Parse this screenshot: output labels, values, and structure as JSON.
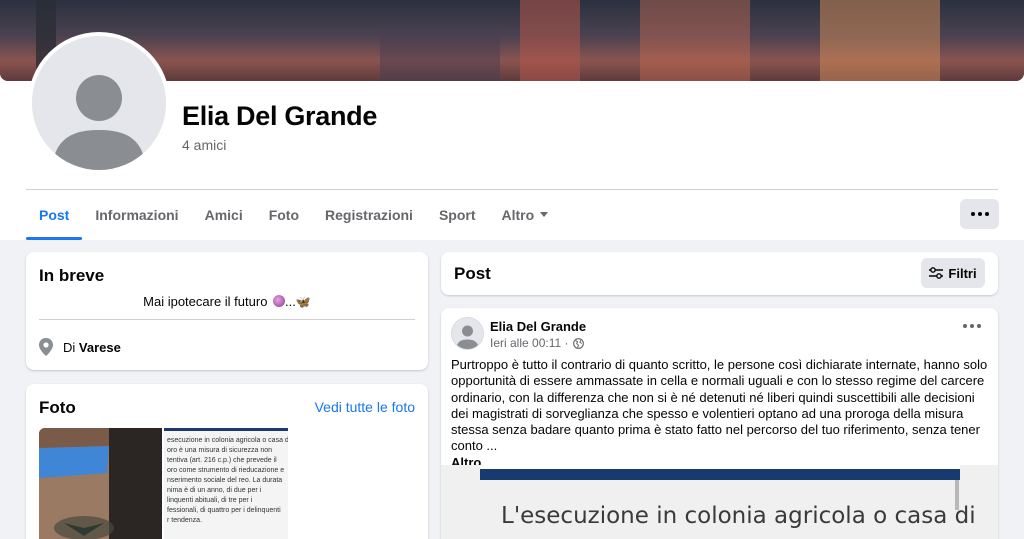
{
  "profile": {
    "name": "Elia Del Grande",
    "friends": "4 amici"
  },
  "tabs": [
    {
      "label": "Post",
      "active": true
    },
    {
      "label": "Informazioni",
      "active": false
    },
    {
      "label": "Amici",
      "active": false
    },
    {
      "label": "Foto",
      "active": false
    },
    {
      "label": "Registrazioni",
      "active": false
    },
    {
      "label": "Sport",
      "active": false
    },
    {
      "label": "Altro",
      "active": false,
      "dropdown": true
    }
  ],
  "intro": {
    "title": "In breve",
    "bio": "Mai ipotecare il futuro",
    "bio_emoji": "🔮...🦋",
    "location_prefix": "Di",
    "location": "Varese"
  },
  "photos": {
    "title": "Foto",
    "see_all": "Vedi tutte le foto",
    "doc_lines": [
      "esecuzione in colonia agricola o casa di",
      "oro è una misura di sicurezza non",
      "tentiva (art. 216 c.p.) che prevede il",
      "oro come strumento di rieducazione e",
      "nserimento sociale del reo. La durata",
      "nima è di un anno, di due per i",
      "linquenti abituali, di tre per i",
      "fessionali, di quattro per i delinquenti",
      "r tendenza."
    ]
  },
  "posts_header": {
    "title": "Post",
    "filter_label": "Filtri"
  },
  "post": {
    "author": "Elia Del Grande",
    "time": "Ieri alle 00:11 ·",
    "text": "Purtroppo è tutto il contrario di quanto scritto, le persone così dichiarate internate, hanno solo opportunità di essere ammassate in cella e normali uguali e con lo stesso regime del carcere ordinario, con la differenza che non si è né detenuti né liberi quindi suscettibili alle decisioni dei magistrati di sorveglianza che spesso e volentieri optano ad una proroga della misura stessa senza badare quanto prima è stato fatto nel percorso del tuo riferimento, senza tener conto ...",
    "more": "Altro...",
    "image_text": "L'esecuzione in colonia agricola o casa di"
  },
  "colors": {
    "accent": "#1877f2",
    "background": "#f0f2f5",
    "secondary_text": "#65676b"
  },
  "icons": [
    "more-dots-icon",
    "location-pin-icon",
    "filter-sliders-icon",
    "globe-icon",
    "dropdown-caret-icon"
  ]
}
